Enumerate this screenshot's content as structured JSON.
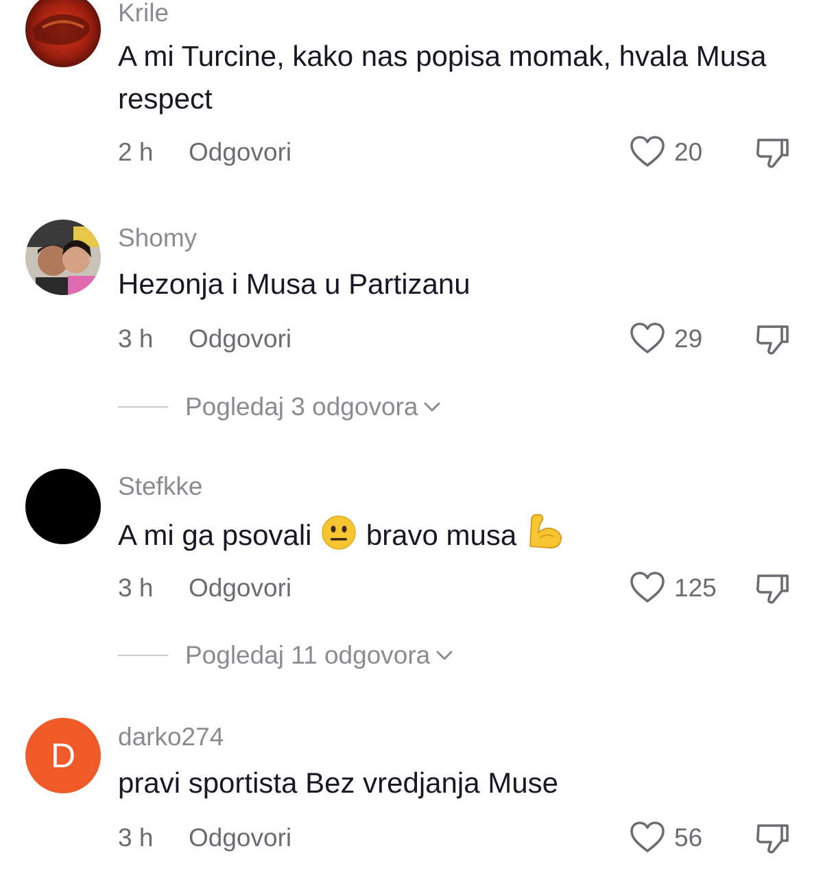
{
  "comments": [
    {
      "username": "Krile",
      "text": "A mi Turcine, kako nas popisa momak, hvala Musa respect",
      "time": "2 h",
      "reply_label": "Odgovori",
      "likes": "20",
      "avatar_icon": "photo-avatar-red"
    },
    {
      "username": "Shomy",
      "text": "Hezonja i Musa u Partizanu",
      "time": "3 h",
      "reply_label": "Odgovori",
      "likes": "29",
      "view_replies": "Pogledaj 3 odgovora",
      "avatar_icon": "photo-avatar-couple"
    },
    {
      "username": "Stefkke",
      "text_part1": "A mi ga psovali",
      "text_part2": " bravo musa",
      "emoji_1": "neutral-face-emoji",
      "emoji_2": "flexed-biceps-emoji",
      "time": "3 h",
      "reply_label": "Odgovori",
      "likes": "125",
      "view_replies": "Pogledaj 11 odgovora",
      "avatar_icon": "black-avatar"
    },
    {
      "username": "darko274",
      "avatar_letter": "D",
      "text": "pravi sportista Bez vredjanja Muse",
      "time": "3 h",
      "reply_label": "Odgovori",
      "likes": "56",
      "avatar_color": "#f05a28"
    }
  ],
  "colors": {
    "text_primary": "#161823",
    "text_secondary": "#8a8b91",
    "meta": "#6b6c72",
    "emoji_yellow": "#f7c531"
  }
}
